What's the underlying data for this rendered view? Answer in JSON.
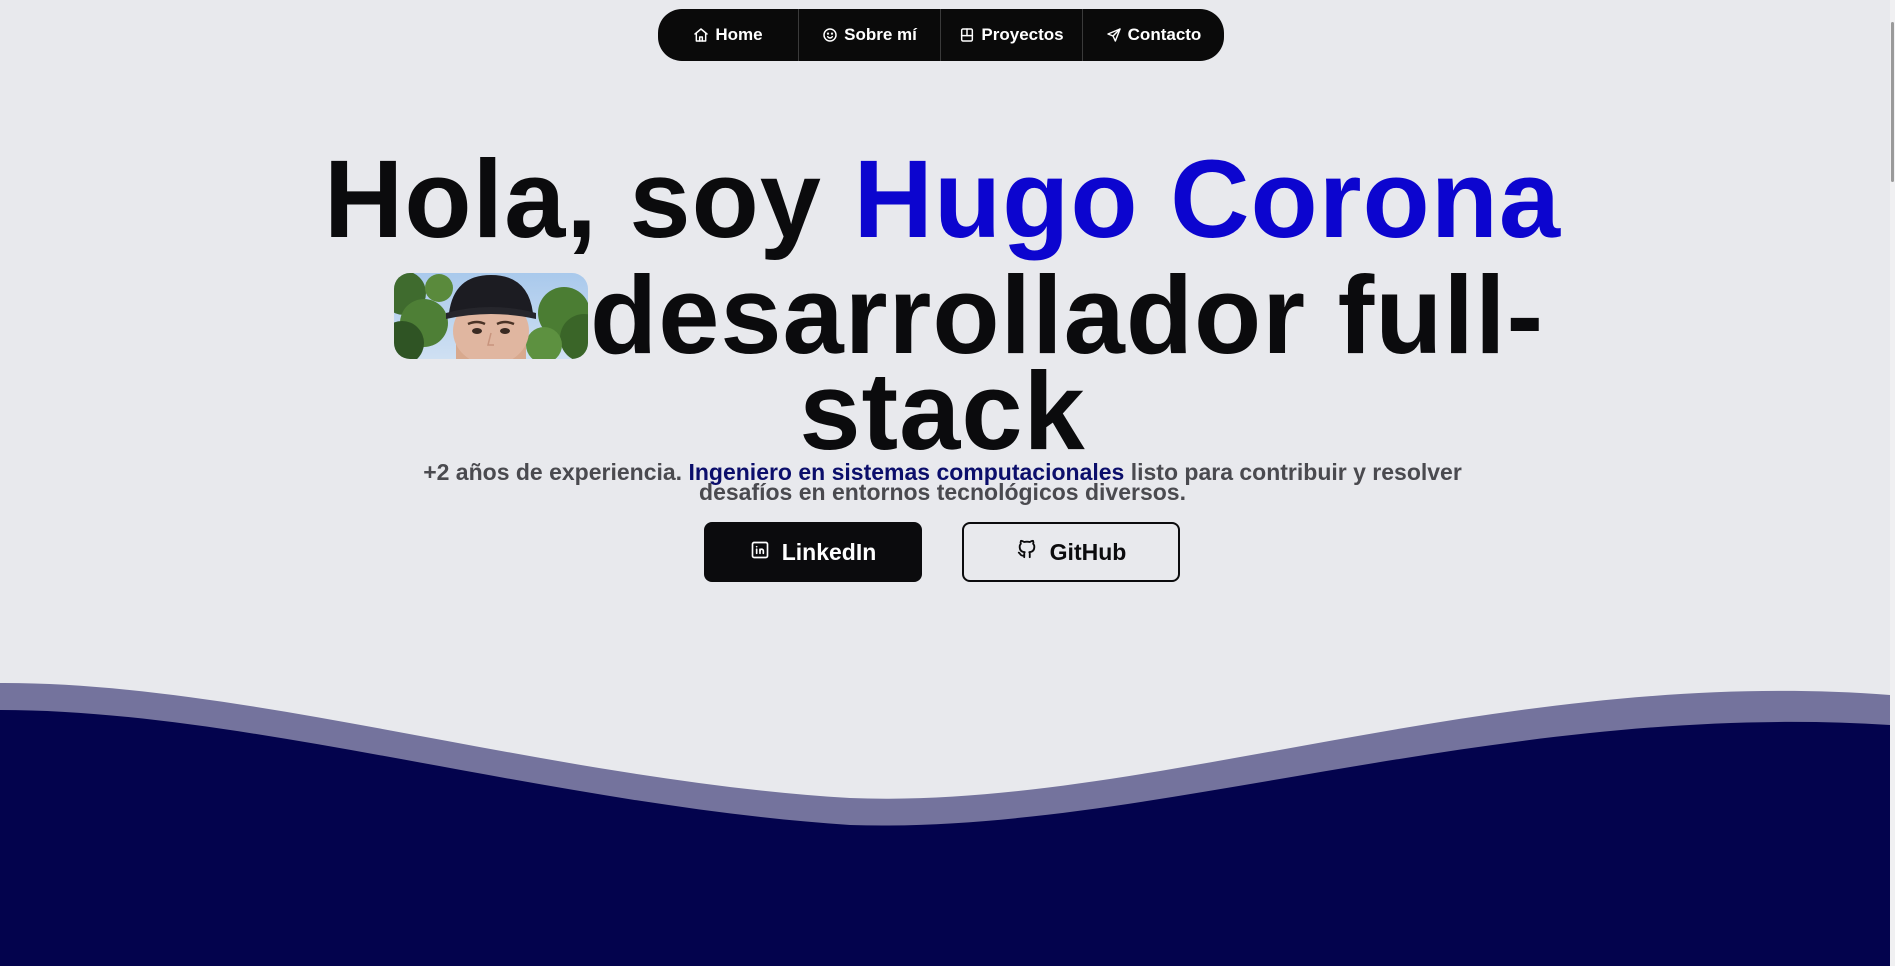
{
  "nav": {
    "items": [
      {
        "label": "Home",
        "icon": "home-icon"
      },
      {
        "label": "Sobre mí",
        "icon": "smile-icon"
      },
      {
        "label": "Proyectos",
        "icon": "projects-icon"
      },
      {
        "label": "Contacto",
        "icon": "send-icon"
      }
    ]
  },
  "hero": {
    "greeting": "Hola, soy",
    "name": "Hugo Corona",
    "role_line1": "desarrollador full-",
    "role_line2": "stack"
  },
  "subtitle": {
    "prefix": "+2 años de experiencia.",
    "highlight": "Ingeniero en sistemas computacionales",
    "suffix": "listo para contribuir y resolver desafíos en entornos tecnológicos diversos."
  },
  "buttons": {
    "linkedin": {
      "label": "LinkedIn",
      "icon": "linkedin-icon"
    },
    "github": {
      "label": "GitHub",
      "icon": "github-icon"
    }
  },
  "colors": {
    "background": "#e8e9ed",
    "accent": "#0c05cf",
    "highlight": "#0b0e6b",
    "wave_dark": "#03034d",
    "wave_light": "#74739d",
    "nav_bg": "#0a0a0a"
  }
}
